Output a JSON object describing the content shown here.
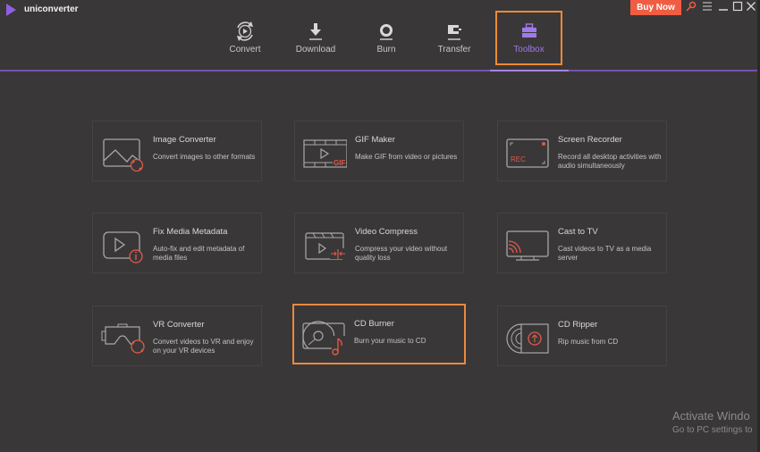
{
  "app": {
    "title": "uniconverter",
    "logo_icon": "play-triangle-icon"
  },
  "titlebar": {
    "buy_now": "Buy Now",
    "key_icon": "key-icon",
    "menu_icon": "hamburger-menu-icon",
    "minimize_icon": "minimize-icon",
    "maximize_icon": "maximize-icon",
    "close_icon": "close-icon"
  },
  "nav": {
    "items": [
      {
        "label": "Convert",
        "icon": "convert-icon"
      },
      {
        "label": "Download",
        "icon": "download-icon"
      },
      {
        "label": "Burn",
        "icon": "burn-icon"
      },
      {
        "label": "Transfer",
        "icon": "transfer-icon"
      },
      {
        "label": "Toolbox",
        "icon": "toolbox-icon",
        "active": true
      }
    ]
  },
  "colors": {
    "accent_purple": "#8f5fe0",
    "highlight_orange": "#e98a3d",
    "buy_now_bg": "#f05d42",
    "icon_red": "#e05a4a",
    "background": "#3a3738"
  },
  "tools": [
    {
      "title": "Image Converter",
      "desc": "Convert images to other formats",
      "icon": "image-converter-icon"
    },
    {
      "title": "GIF Maker",
      "desc": "Make GIF from video or pictures",
      "icon": "gif-maker-icon"
    },
    {
      "title": "Screen Recorder",
      "desc": "Record all desktop activities with audio simultaneously",
      "icon": "screen-recorder-icon"
    },
    {
      "title": "Fix Media Metadata",
      "desc": "Auto-fix and edit metadata of media files",
      "icon": "fix-metadata-icon"
    },
    {
      "title": "Video Compress",
      "desc": "Compress your video without quality loss",
      "icon": "video-compress-icon"
    },
    {
      "title": "Cast to TV",
      "desc": "Cast videos to TV as a media server",
      "icon": "cast-to-tv-icon"
    },
    {
      "title": "VR Converter",
      "desc": "Convert videos to VR and enjoy on your VR devices",
      "icon": "vr-converter-icon"
    },
    {
      "title": "CD Burner",
      "desc": "Burn your music to CD",
      "icon": "cd-burner-icon",
      "selected": true
    },
    {
      "title": "CD Ripper",
      "desc": "Rip music from CD",
      "icon": "cd-ripper-icon"
    }
  ],
  "watermark": {
    "line1": "Activate Windo",
    "line2": "Go to PC settings to"
  }
}
